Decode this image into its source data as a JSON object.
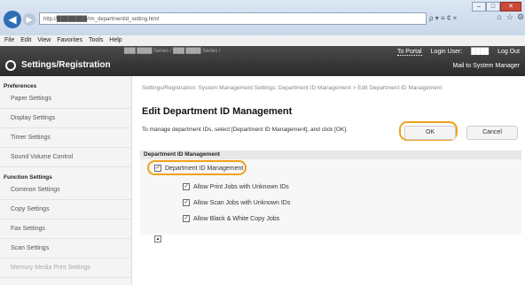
{
  "browser": {
    "url": "http://████████/rm_departmentid_setting.html",
    "url_tools": "ρ ▾ ≡ ¢ ×",
    "menu": [
      "File",
      "Edit",
      "View",
      "Favorites",
      "Tools",
      "Help"
    ]
  },
  "app": {
    "title": "Settings/Registration",
    "model": "███ ████ Series / ███ ████ Series /",
    "to_portal": "To Portal",
    "login_user_label": "Login User:",
    "login_user_name": "████",
    "log_out": "Log Out",
    "mail_link": "Mail to System Manager"
  },
  "sidebar": {
    "preferences_label": "Preferences",
    "preferences_items": [
      "Paper Settings",
      "Display Settings",
      "Timer Settings",
      "Sound Volume Control"
    ],
    "function_label": "Function Settings",
    "function_items": [
      "Common Settings",
      "Copy Settings",
      "Fax Settings",
      "Scan Settings",
      "Memory Media Print Settings"
    ]
  },
  "main": {
    "breadcrumb": "Settings/Registration: System Management Settings: Department ID Management > Edit Department ID Management",
    "title": "Edit Department ID Management",
    "instruction": "To manage department IDs, select [Department ID Management], and click [OK].",
    "ok_label": "OK",
    "cancel_label": "Cancel",
    "section_label": "Department ID Management",
    "main_checkbox_label": "Department ID Management",
    "sub_options": [
      "Allow Print Jobs with Unknown IDs",
      "Allow Scan Jobs with Unknown IDs",
      "Allow Black & White Copy Jobs"
    ]
  },
  "colors": {
    "highlight": "#f0a21b",
    "header_bg": "#2b2b2b"
  }
}
